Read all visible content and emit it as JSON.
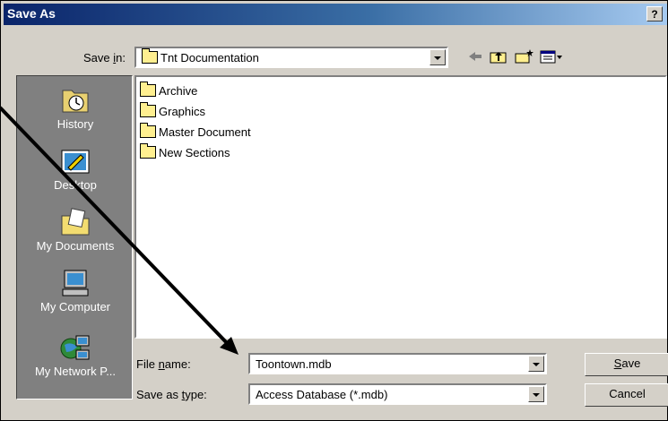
{
  "window": {
    "title": "Save As",
    "help_label": "?",
    "close_label": "×"
  },
  "save_in": {
    "label_prefix": "Save ",
    "label_access_key": "i",
    "label_suffix": "n:",
    "value": "Tnt Documentation"
  },
  "places": [
    {
      "label": "History",
      "icon": "history-icon"
    },
    {
      "label": "Desktop",
      "icon": "desktop-icon"
    },
    {
      "label": "My Documents",
      "icon": "my-documents-icon"
    },
    {
      "label": "My Computer",
      "icon": "my-computer-icon"
    },
    {
      "label": "My Network P...",
      "icon": "my-network-places-icon"
    }
  ],
  "files": [
    {
      "name": "Archive"
    },
    {
      "name": "Graphics"
    },
    {
      "name": "Master Document"
    },
    {
      "name": "New Sections"
    }
  ],
  "file_name": {
    "label_prefix": "File ",
    "label_access_key": "n",
    "label_suffix": "ame:",
    "value": "Toontown.mdb"
  },
  "save_as_type": {
    "label_prefix": "Save as ",
    "label_access_key": "t",
    "label_suffix": "ype:",
    "value": "Access Database (*.mdb)"
  },
  "buttons": {
    "save_access_key": "S",
    "save_rest": "ave",
    "cancel": "Cancel"
  },
  "toolbar": {
    "back_icon": "back-arrow-icon",
    "up_icon": "up-folder-icon",
    "new_folder_icon": "new-folder-icon",
    "views_icon": "views-menu-icon"
  },
  "annotation": {
    "arrow_color": "#000000"
  }
}
